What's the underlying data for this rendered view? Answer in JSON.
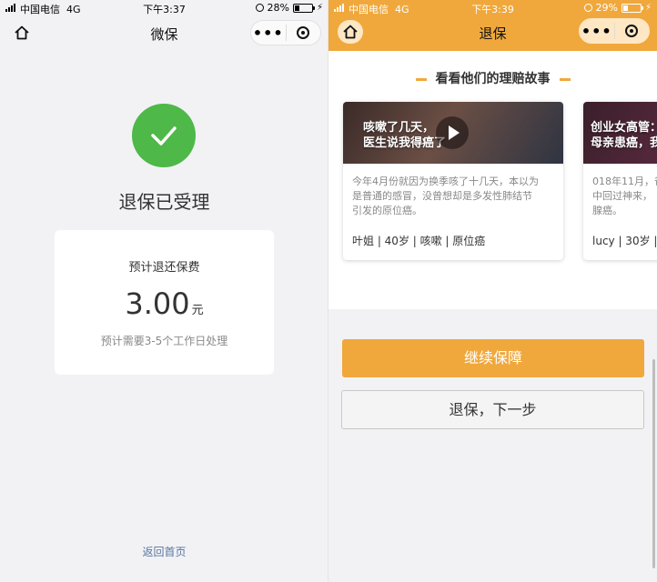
{
  "left": {
    "status": {
      "carrier": "中国电信",
      "network": "4G",
      "time": "下午3:37",
      "battery": "28%",
      "battery_level": 0.28
    },
    "nav": {
      "title": "微保"
    },
    "result": {
      "title": "退保已受理",
      "refund_label": "预计退还保费",
      "amount": "3.00",
      "unit": "元",
      "note": "预计需要3-5个工作日处理",
      "status_color": "#4eb849"
    },
    "back_home": "返回首页"
  },
  "right": {
    "status": {
      "carrier": "中国电信",
      "network": "4G",
      "time": "下午3:39",
      "battery": "29%",
      "battery_level": 0.29
    },
    "nav": {
      "title": "退保"
    },
    "stories": {
      "heading": "看看他们的理赔故事",
      "cards": [
        {
          "thumb_title_line1": "咳嗽了几天，",
          "thumb_title_line2": "医生说我得癌了",
          "desc_line1": "今年4月份就因为换季咳了十几天，本以为",
          "desc_line2": "是普通的感冒，没曾想却是多发性肺结节",
          "desc_line3": "引发的原位癌。",
          "tags": "叶姐 | 40岁 | 咳嗽 | 原位癌"
        },
        {
          "thumb_title_line1": "创业女高管：",
          "thumb_title_line2": "母亲患癌，我",
          "desc_line1": "018年11月，爸",
          "desc_line2": "中回过神来，",
          "desc_line3": "腺癌。",
          "tags": "lucy | 30岁 | "
        }
      ]
    },
    "buttons": {
      "continue": "继续保障",
      "next": "退保，下一步"
    },
    "accent_color": "#f0a83c"
  }
}
